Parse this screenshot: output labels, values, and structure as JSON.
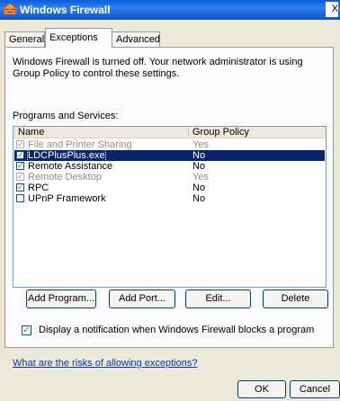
{
  "window": {
    "title": "Windows Firewall",
    "close_glyph": "X"
  },
  "tabs": [
    {
      "label": "General",
      "active": false
    },
    {
      "label": "Exceptions",
      "active": true
    },
    {
      "label": "Advanced",
      "active": false
    }
  ],
  "info_text": "Windows Firewall is turned off. Your network administrator is using Group Policy to control these settings.",
  "programs_label": "Programs and Services:",
  "list": {
    "columns": [
      "Name",
      "Group Policy"
    ],
    "rows": [
      {
        "name": "File and Printer Sharing",
        "group_policy": "Yes",
        "checked": true,
        "disabled": true,
        "selected": false
      },
      {
        "name": "LDCPlusPlus.exe",
        "group_policy": "No",
        "checked": true,
        "disabled": false,
        "selected": true
      },
      {
        "name": "Remote Assistance",
        "group_policy": "No",
        "checked": true,
        "disabled": false,
        "selected": false
      },
      {
        "name": "Remote Desktop",
        "group_policy": "Yes",
        "checked": true,
        "disabled": true,
        "selected": false
      },
      {
        "name": "RPC",
        "group_policy": "No",
        "checked": true,
        "disabled": false,
        "selected": false
      },
      {
        "name": "UPnP Framework",
        "group_policy": "No",
        "checked": false,
        "disabled": false,
        "selected": false
      }
    ]
  },
  "buttons": {
    "add_program": "Add Program...",
    "add_port": "Add Port...",
    "edit": "Edit...",
    "delete": "Delete",
    "ok": "OK",
    "cancel": "Cancel"
  },
  "notify": {
    "label": "Display a notification when Windows Firewall blocks a program",
    "checked": true
  },
  "risks_link": "What are the risks of allowing exceptions?",
  "colors": {
    "title_bar": "#0a5fd8",
    "selection": "#0a246a",
    "link": "#0033cc"
  },
  "icons": {
    "title": "firewall-icon",
    "checkbox": "checkmark-icon"
  }
}
